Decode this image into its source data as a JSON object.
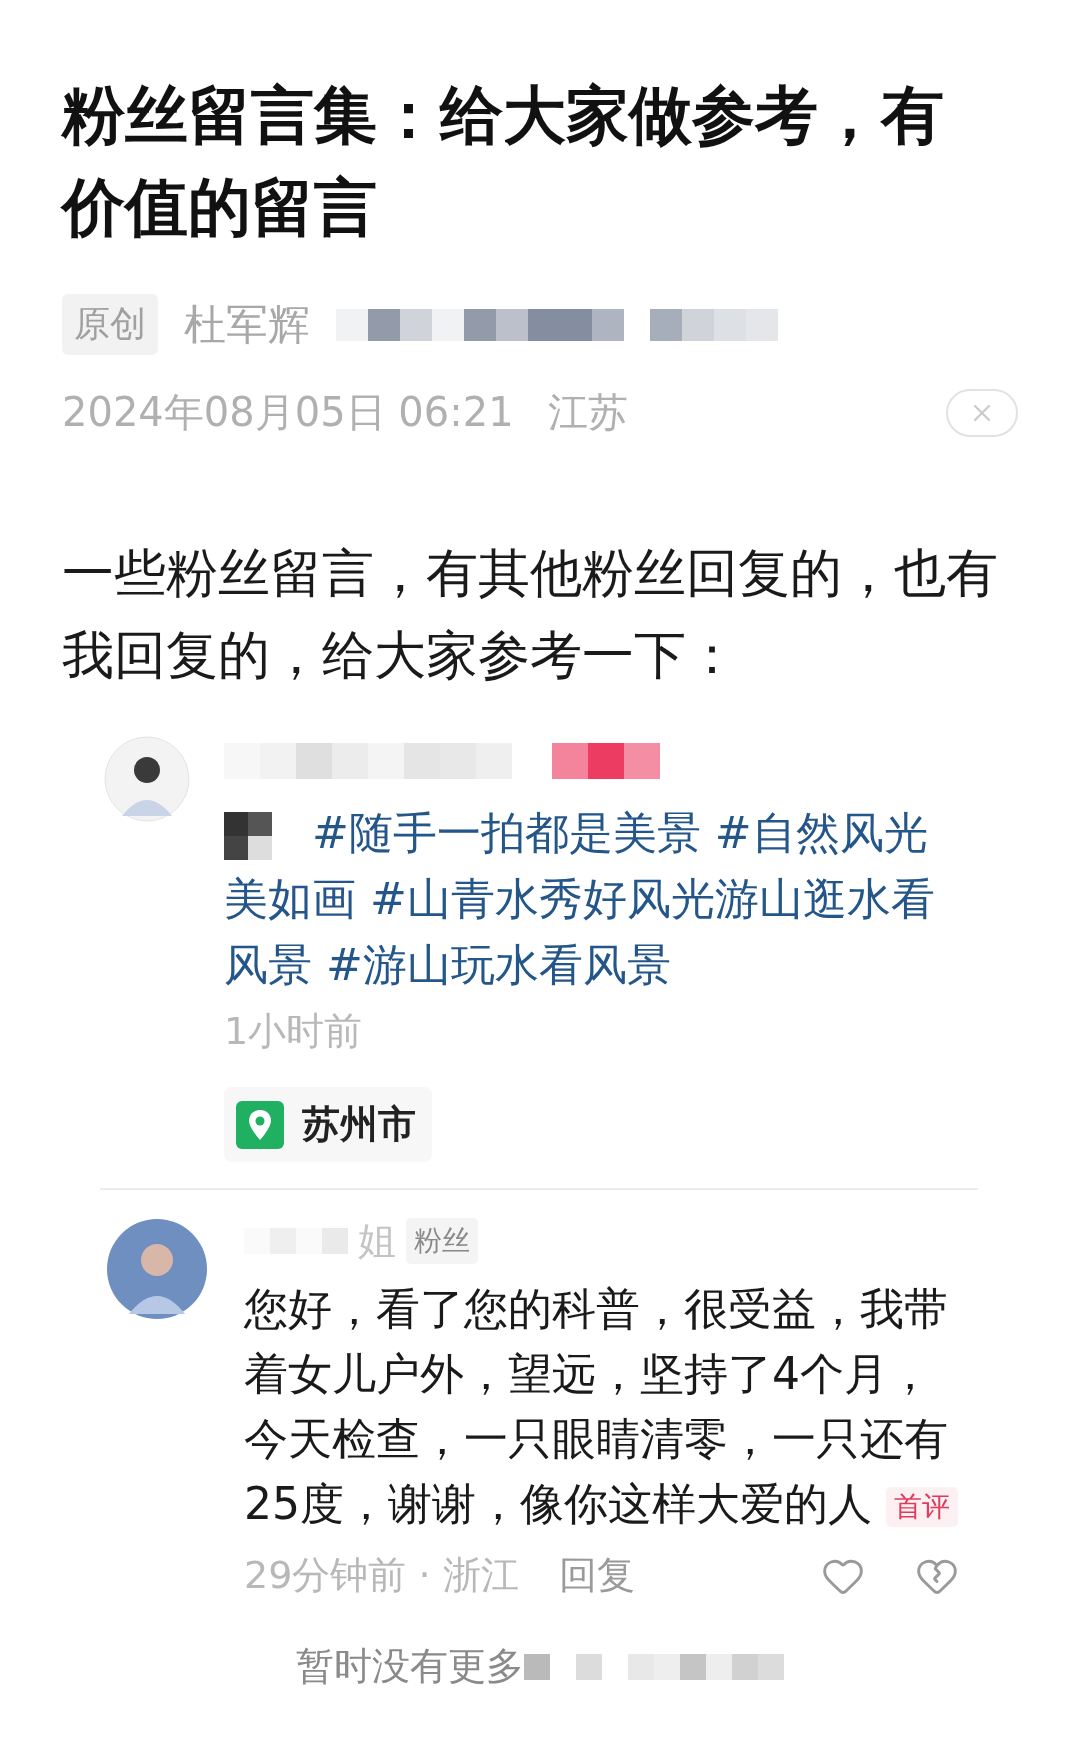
{
  "title": "粉丝留言集：给大家做参考，有价值的留言",
  "meta": {
    "badge": "原创",
    "author": "杜军辉",
    "date": "2024年08月05日 06:21",
    "region": "江苏"
  },
  "intro": "一些粉丝留言，有其他粉丝回复的，也有我回复的，给大家参考一下：",
  "comments": [
    {
      "kind": "post",
      "text": "#随手一拍都是美景 #自然风光美如画 #山青水秀好风光游山逛水看风景 #游山玩水看风景",
      "time": "1小时前",
      "location": "苏州市"
    },
    {
      "kind": "comment",
      "name": "姐",
      "tag": "粉丝",
      "text": "您好，看了您的科普，很受益，我带着女儿户外，望远，坚持了4个月，今天检查，一只眼睛清零，一只还有25度，谢谢，像你这样大爱的人",
      "badge": "首评",
      "time": "29分钟前 · 浙江",
      "reply": "回复"
    }
  ],
  "footer": "暂时没有更多"
}
